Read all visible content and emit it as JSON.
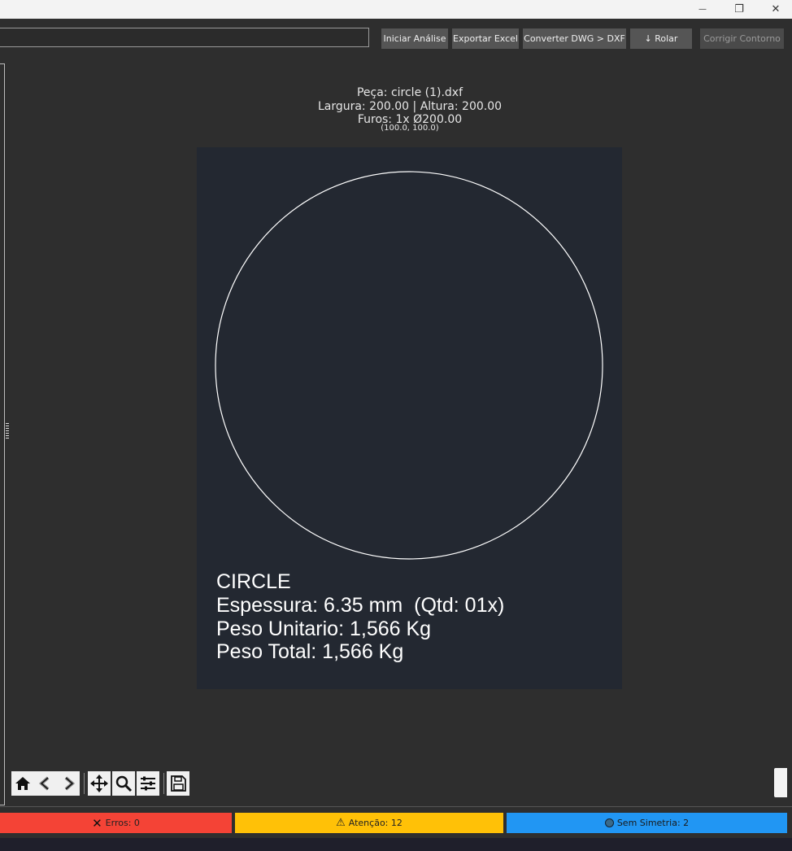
{
  "toolbar": {
    "path_value": "",
    "buttons": {
      "analyze": "Iniciar Análise",
      "export": "Exportar Excel",
      "convert": "Converter DWG > DXF",
      "scroll": "↓ Rolar",
      "fix": "Corrigir Contorno"
    }
  },
  "window_controls": {
    "minimize": "—",
    "restore": "❐",
    "close": "✕"
  },
  "info": {
    "piece": "Peça: circle (1).dxf",
    "dims": "Largura: 200.00 | Altura: 200.00",
    "holes": "Furos: 1x Ø200.00",
    "center": "(100.0, 100.0)"
  },
  "part": {
    "name": "CIRCLE",
    "thickness": "Espessura: 6.35 mm  (Qtd: 01x)",
    "unit_weight": "Peso Unitario: 1,566 Kg",
    "total_weight": "Peso Total: 1,566 Kg"
  },
  "nav_icons": [
    "home-icon",
    "back-arrow-icon",
    "forward-arrow-icon",
    "pan-icon",
    "zoom-icon",
    "configure-subplots-icon",
    "save-icon"
  ],
  "status": {
    "errors": "Erros: 0",
    "warnings": "Atenção: 12",
    "symmetry": "Sem Simetria: 2",
    "colors": {
      "errors": "#f44336",
      "warnings": "#ffc107",
      "symmetry": "#2196f3"
    }
  }
}
